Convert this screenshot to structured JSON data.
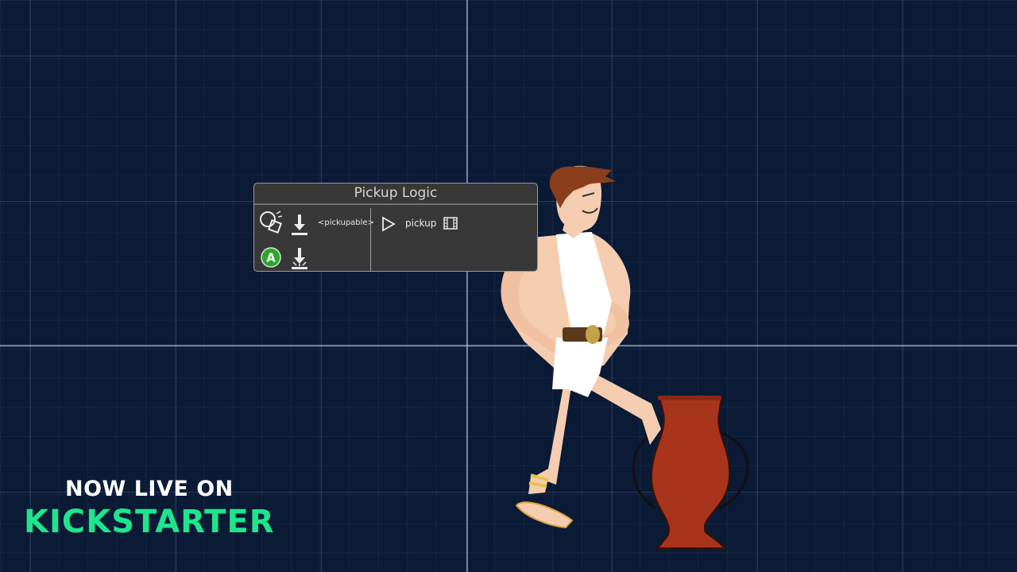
{
  "node": {
    "title": "Pickup Logic",
    "tag_label": "<pickupable>",
    "action_label": "pickup",
    "icons": [
      "collision-shapes-icon",
      "download-icon",
      "a-button-icon",
      "download-splash-icon",
      "play-icon",
      "film-icon"
    ]
  },
  "promo": {
    "line1": "NOW LIVE ON",
    "line2": "KICKSTARTER"
  },
  "colors": {
    "background": "#0b1a35",
    "node_bg": "#383838",
    "kickstarter_green": "#1ee58c",
    "a_button_green": "#2fa52f",
    "vase": "#a8341c"
  }
}
